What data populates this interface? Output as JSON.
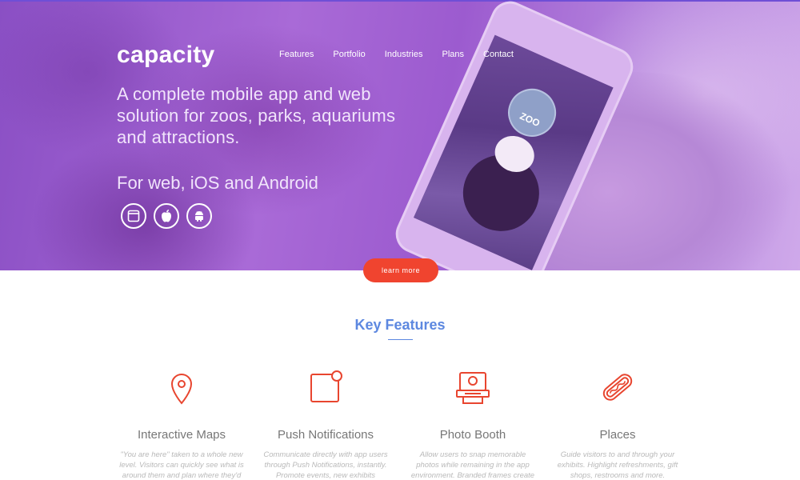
{
  "brand": {
    "logo_text": "capacity"
  },
  "nav": {
    "items": [
      {
        "label": "Features"
      },
      {
        "label": "Portfolio"
      },
      {
        "label": "Industries"
      },
      {
        "label": "Plans"
      },
      {
        "label": "Contact"
      }
    ]
  },
  "hero": {
    "headline": "A complete mobile app and web solution for zoos, parks, aquariums and attractions.",
    "platforms_title": "For web, iOS and Android",
    "platform_icons": [
      "web-icon",
      "apple-icon",
      "android-icon"
    ],
    "phone_screen_badge": "ZOO",
    "cta_label": "learn more"
  },
  "key_features": {
    "title": "Key Features",
    "items": [
      {
        "icon": "map-pin-icon",
        "title": "Interactive Maps",
        "description": "\"You are here\" taken to a whole new level. Visitors can quickly see what is around them and plan where they'd"
      },
      {
        "icon": "notification-icon",
        "title": "Push Notifications",
        "description": "Communicate directly with app users through Push Notifications, instantly. Promote events, new exhibits"
      },
      {
        "icon": "camera-icon",
        "title": "Photo Booth",
        "description": "Allow users to snap memorable photos while remaining in the app environment. Branded frames create"
      },
      {
        "icon": "hotdog-icon",
        "title": "Places",
        "description": "Guide visitors to and through your exhibits. Highlight refreshments, gift shops, restrooms and more."
      }
    ]
  },
  "colors": {
    "hero_purple": "#9c5bcf",
    "cta_red": "#f0442f",
    "accent_blue": "#5d88e0",
    "icon_red": "#e8452f"
  }
}
